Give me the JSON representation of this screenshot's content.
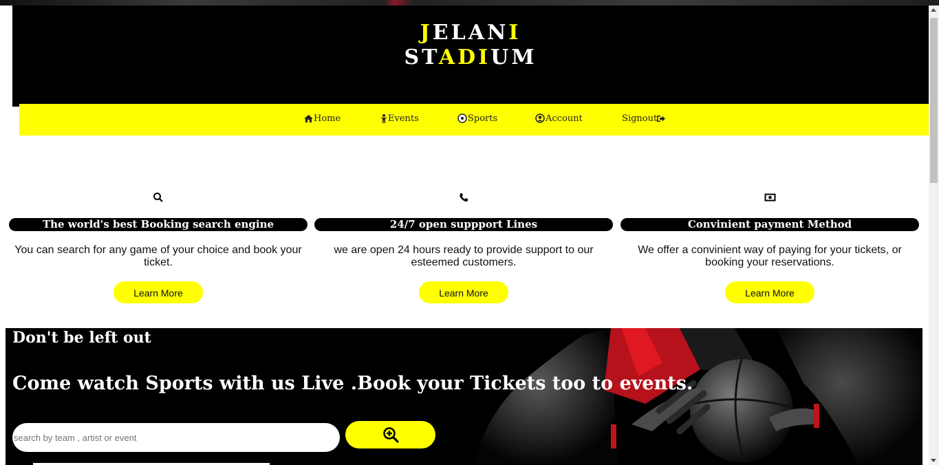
{
  "logo": {
    "line1_a": "J",
    "line1_b": "ELAN",
    "line1_c": "I",
    "line2_a": "ST",
    "line2_b": "ADI",
    "line2_c": "UM"
  },
  "nav": {
    "home": "Home",
    "events": "Events",
    "sports": "Sports",
    "account": "Account",
    "signout": "Signout"
  },
  "features": [
    {
      "icon": "search-icon",
      "title": "The world's best Booking search engine",
      "desc": "You can search for any game of your choice and book your ticket.",
      "button": "Learn More"
    },
    {
      "icon": "phone-icon",
      "title": "24/7 open suppport Lines",
      "desc": "we are open 24 hours ready to provide support to our esteemed customers.",
      "button": "Learn More"
    },
    {
      "icon": "money-icon",
      "title": "Convinient payment Method",
      "desc": "We offer a convinient way of paying for your tickets, or booking your reservations.",
      "button": "Learn More"
    }
  ],
  "hero": {
    "heading": "Don't be left out",
    "subheading": "Come watch Sports with us Live .Book your Tickets too to events.",
    "search_placeholder": "search by team , artist or event"
  },
  "colors": {
    "accent": "#ffff00",
    "header_bg": "#000000",
    "text": "#111111"
  }
}
